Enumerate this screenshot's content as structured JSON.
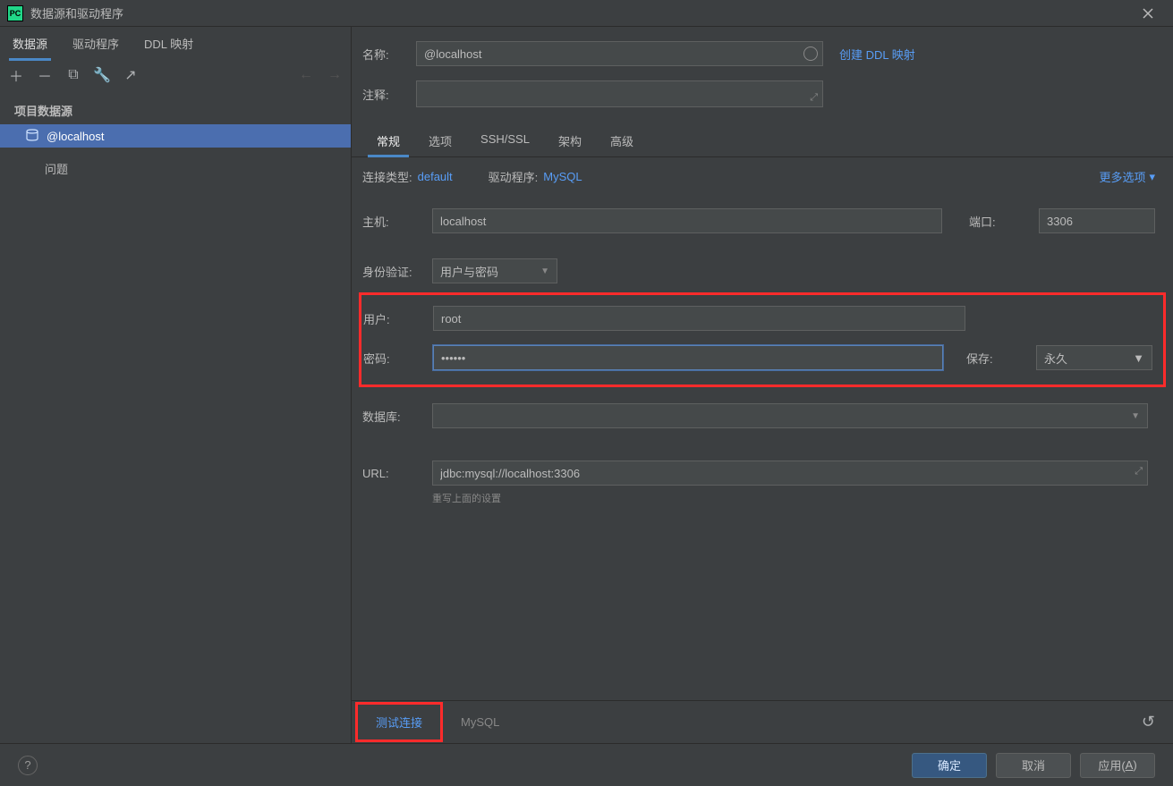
{
  "window": {
    "title": "数据源和驱动程序"
  },
  "sidebar": {
    "tabs": [
      "数据源",
      "驱动程序",
      "DDL 映射"
    ],
    "section_header": "项目数据源",
    "items": [
      {
        "label": "@localhost"
      }
    ],
    "problems": "问题"
  },
  "form": {
    "name_label": "名称:",
    "name_value": "@localhost",
    "create_ddl_link": "创建 DDL 映射",
    "comment_label": "注释:",
    "comment_value": ""
  },
  "content_tabs": [
    "常规",
    "选项",
    "SSH/SSL",
    "架构",
    "高级"
  ],
  "conn": {
    "type_label": "连接类型:",
    "type_value": "default",
    "driver_label": "驱动程序:",
    "driver_value": "MySQL",
    "more_options": "更多选项"
  },
  "fields": {
    "host_label": "主机:",
    "host_value": "localhost",
    "port_label": "端口:",
    "port_value": "3306",
    "auth_label": "身份验证:",
    "auth_value": "用户与密码",
    "user_label": "用户:",
    "user_value": "root",
    "pass_label": "密码:",
    "pass_value": "••••••",
    "save_label": "保存:",
    "save_value": "永久",
    "db_label": "数据库:",
    "db_value": "",
    "url_label": "URL:",
    "url_value": "jdbc:mysql://localhost:3306",
    "url_note": "重写上面的设置"
  },
  "bottom": {
    "test_connection": "测试连接",
    "driver_name": "MySQL"
  },
  "footer": {
    "ok": "确定",
    "cancel": "取消",
    "apply_prefix": "应用(",
    "apply_key": "A",
    "apply_suffix": ")"
  }
}
